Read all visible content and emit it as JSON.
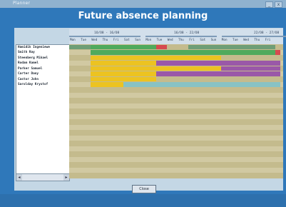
{
  "window": {
    "title": "Planner",
    "minimize_label": "_",
    "close_label": "x"
  },
  "heading": "Future absence planning",
  "weeks": [
    "1O/O8 - 16/O8",
    "16/O8 - 22/O8",
    "22/O8 - 27/O8"
  ],
  "days": [
    "Mon",
    "Tue",
    "Wed",
    "Thu",
    "Fri",
    "Sat",
    "Sun",
    "Mon",
    "Tue",
    "Wed",
    "Thu",
    "Fri",
    "Sat",
    "Sun",
    "Mon",
    "Tue",
    "Wed",
    "Thu",
    "Fri"
  ],
  "employees": [
    "Hamidik Ingeniewe",
    "Smith Ray",
    "Steenberg Mikael",
    "Rodam Kamel",
    "Parker Samuel",
    "Carter Dany",
    "Castor John",
    "Sarolday Krystof"
  ],
  "absences": [
    {
      "row": 0,
      "start": 0,
      "end": 2,
      "color": "#6e9e76"
    },
    {
      "row": 0,
      "start": 2,
      "end": 8,
      "color": "#4faa5c"
    },
    {
      "row": 0,
      "start": 8,
      "end": 9,
      "color": "#d64a4f"
    },
    {
      "row": 0,
      "start": 11,
      "end": 19,
      "color": "#6e9e76"
    },
    {
      "row": 1,
      "start": 2,
      "end": 19,
      "color": "#4faa5c"
    },
    {
      "row": 1,
      "start": 19,
      "end": 19.5,
      "color": "#d64a4f"
    },
    {
      "row": 2,
      "start": 2,
      "end": 14,
      "color": "#ecc321"
    },
    {
      "row": 3,
      "start": 2,
      "end": 8,
      "color": "#ecc321"
    },
    {
      "row": 3,
      "start": 8,
      "end": 19.5,
      "color": "#9a58a8"
    },
    {
      "row": 4,
      "start": 2,
      "end": 14,
      "color": "#ecc321"
    },
    {
      "row": 4,
      "start": 14,
      "end": 19.5,
      "color": "#9a58a8"
    },
    {
      "row": 5,
      "start": 2,
      "end": 8,
      "color": "#ecc321"
    },
    {
      "row": 5,
      "start": 8,
      "end": 19.5,
      "color": "#9a58a8"
    },
    {
      "row": 6,
      "start": 2,
      "end": 8,
      "color": "#ecc321"
    },
    {
      "row": 7,
      "start": 2,
      "end": 5,
      "color": "#ecc321"
    },
    {
      "row": 7,
      "start": 5,
      "end": 19.5,
      "color": "#88c2c4"
    }
  ],
  "colors": {
    "row_a": "#c4bb8d",
    "row_b": "#d1c9a2",
    "frame": "#2f78ba"
  },
  "close_button": "Close"
}
